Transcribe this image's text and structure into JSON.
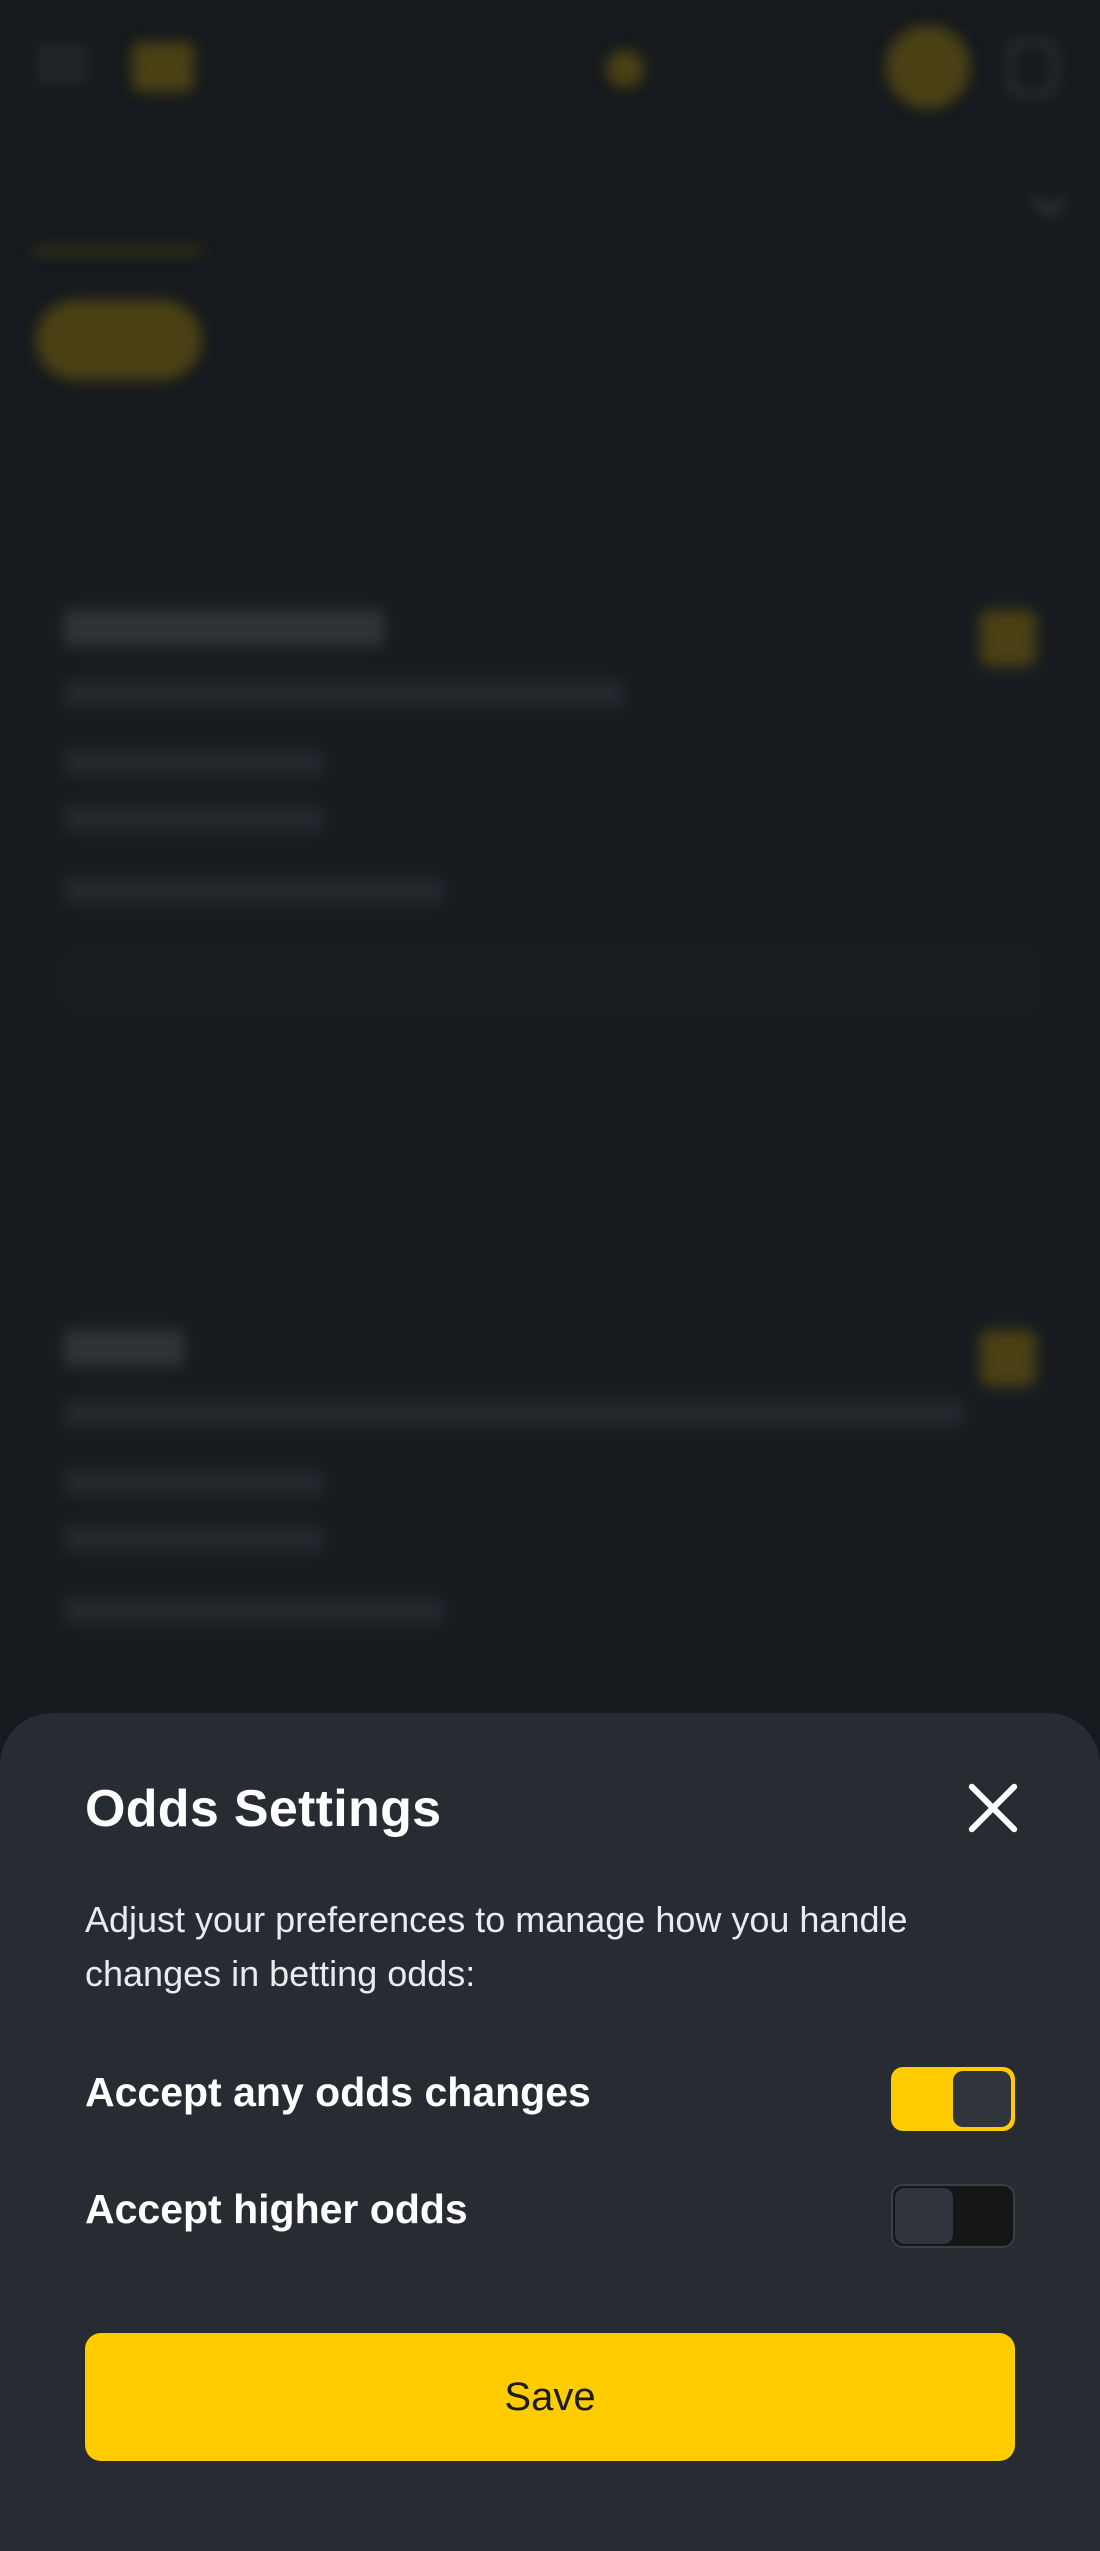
{
  "sheet": {
    "title": "Odds Settings",
    "close_icon": "close-icon",
    "description": "Adjust your preferences to manage how you handle changes in betting odds:",
    "options": [
      {
        "label": "Accept any odds changes",
        "enabled": true
      },
      {
        "label": "Accept higher odds",
        "enabled": false
      }
    ],
    "save_label": "Save"
  },
  "colors": {
    "accent": "#ffcc00",
    "sheet_background": "#272c33",
    "page_background": "#1d2024",
    "toggle_off_track": "#141618",
    "toggle_knob": "#2f343d"
  },
  "background_icons": [
    "menu-icon",
    "logo-icon",
    "coin-icon",
    "user-icon"
  ]
}
